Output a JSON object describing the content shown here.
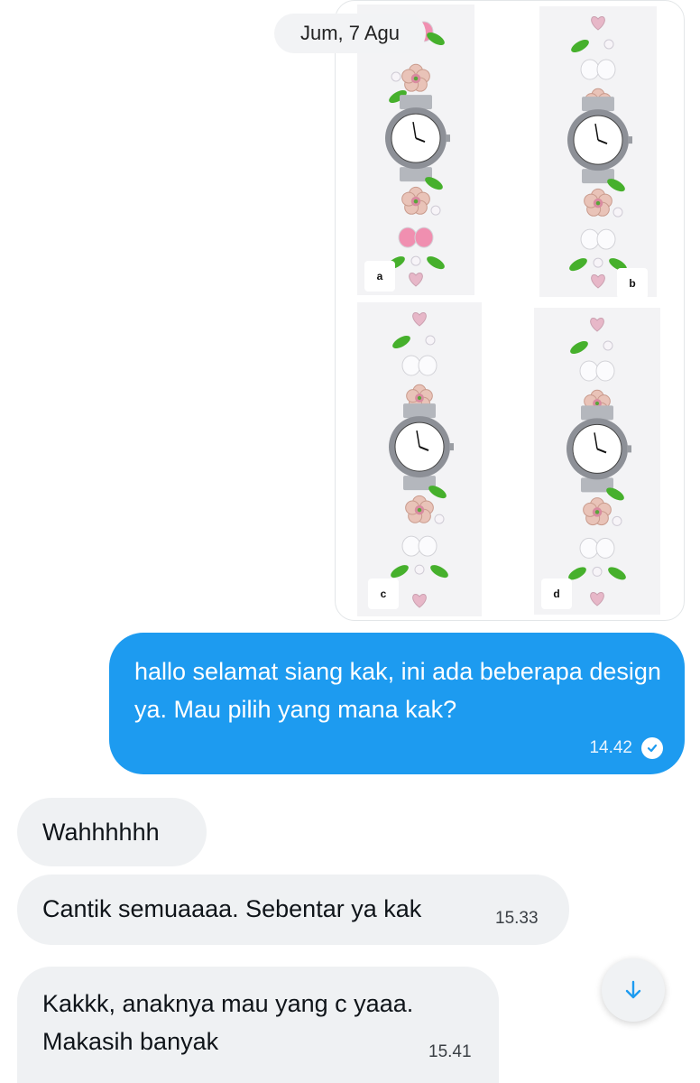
{
  "date_separator": "Jum, 7 Agu",
  "attachment": {
    "designs": [
      {
        "label": "a"
      },
      {
        "label": "b"
      },
      {
        "label": "c"
      },
      {
        "label": "d"
      }
    ]
  },
  "messages": [
    {
      "direction": "outgoing",
      "text": "hallo selamat siang kak, ini ada beberapa design ya. Mau pilih yang mana kak?",
      "time": "14.42",
      "status": "read"
    },
    {
      "direction": "incoming",
      "text": "Wahhhhhh",
      "time": ""
    },
    {
      "direction": "incoming",
      "text": "Cantik semuaaaa. Sebentar ya kak",
      "time": "15.33"
    },
    {
      "direction": "incoming",
      "text_lines": [
        "Kakkk, anaknya mau yang c yaaa.",
        "Makasih banyak"
      ],
      "time": "15.41"
    }
  ],
  "colors": {
    "outgoing_bubble": "#1d9bf0",
    "incoming_bubble": "#eff1f3",
    "accent": "#1d9bf0"
  },
  "icons": {
    "read_receipt": "check-circle-icon",
    "scroll_down": "arrow-down-icon"
  }
}
